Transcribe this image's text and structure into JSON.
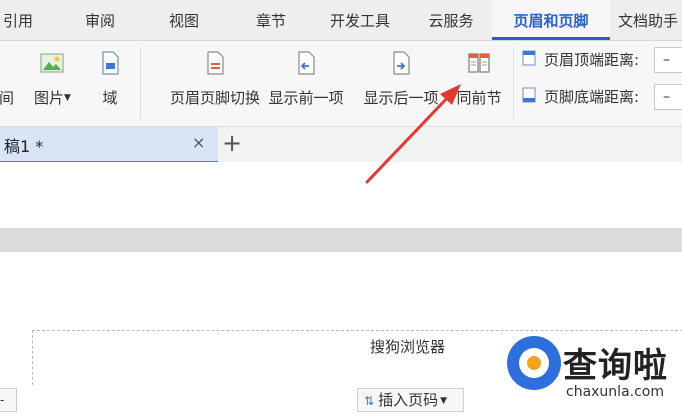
{
  "tabs": [
    {
      "label": "引用"
    },
    {
      "label": "审阅"
    },
    {
      "label": "视图"
    },
    {
      "label": "章节"
    },
    {
      "label": "开发工具"
    },
    {
      "label": "云服务"
    },
    {
      "label": "页眉和页脚"
    },
    {
      "label": "文档助手"
    }
  ],
  "active_tab_index": 6,
  "ribbon": {
    "time_label": "时间",
    "picture_label": "图片",
    "field_label": "域",
    "switch_label": "页眉页脚切换",
    "prev_label": "显示前一项",
    "next_label": "显示后一项",
    "same_prev_label": "同前节",
    "header_top_label": "页眉顶端距离:",
    "footer_bottom_label": "页脚底端距离:",
    "header_top_value": "–",
    "footer_bottom_value": "–"
  },
  "doc_tab": {
    "label": "稿1 *",
    "close": "×",
    "new_tab": "+"
  },
  "page": {
    "header_text": "搜狗浏览器",
    "insert_page_number": "插入页码",
    "left_stub": "-"
  },
  "watermark": {
    "title": "查询啦",
    "url": "chaxunla.com"
  },
  "colors": {
    "accent": "#2a63c8",
    "arrow": "#e03a33",
    "doc_tab_bg": "#d9e4f5"
  }
}
